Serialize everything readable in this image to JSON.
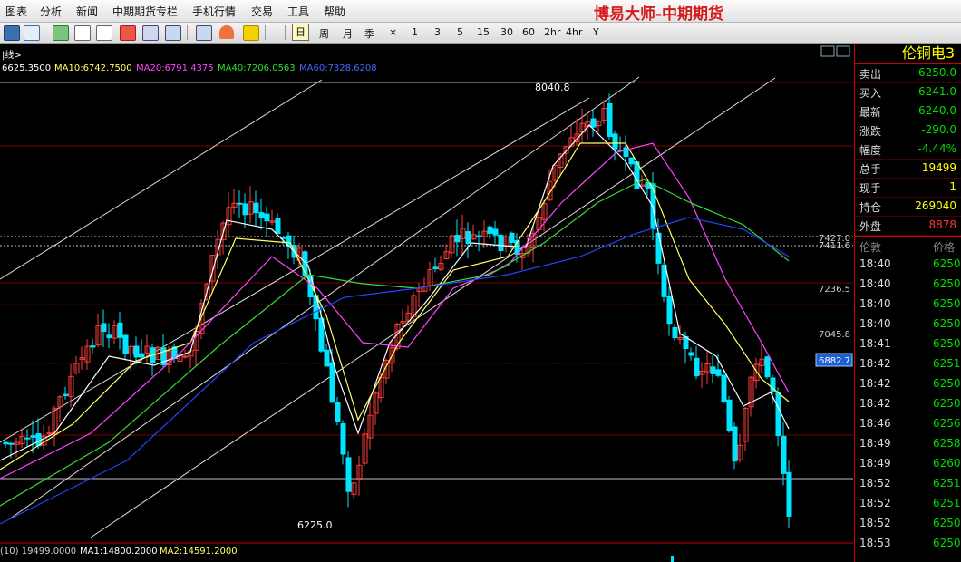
{
  "menu": {
    "items": [
      "图表",
      "分析",
      "新闻",
      "中期期货专栏",
      "手机行情",
      "交易",
      "工具",
      "帮助"
    ],
    "brand": "博易大师-中期期货"
  },
  "toolbar": {
    "periods": [
      "日",
      "周",
      "月",
      "季",
      "×",
      "1",
      "3",
      "5",
      "15",
      "30",
      "60",
      "2hr",
      "4hr",
      "Y"
    ],
    "active_period": "日"
  },
  "chart": {
    "indicator": {
      "prefix": "|线>",
      "close": "6625.3500",
      "ma10": "MA10:6742.7500",
      "ma20": "MA20:6791.4375",
      "ma40": "MA40:7206.0563",
      "ma60": "MA60:7328.6208"
    },
    "price_marks": {
      "high": "8040.8",
      "low": "6225.0",
      "r1": "7427.0",
      "r2": "7411.6",
      "r3": "7236.5",
      "r4": "7045.8",
      "cursor": "6882.7"
    },
    "volume_line": {
      "vol": "(10) 19499.0000",
      "ma1": "MA1:14800.2000",
      "ma2": "MA2:14591.2000"
    },
    "colors": {
      "up": "#ff3b3b",
      "down": "#00e5ff",
      "ma5": "#ffffff",
      "ma10": "#ffff66",
      "ma20": "#ff44ff",
      "ma40": "#33dd33",
      "ma60": "#2244ff"
    }
  },
  "quote": {
    "title": "伦铜电3",
    "rows": [
      {
        "label": "卖出",
        "value": "6250.0",
        "color": "#00dd00"
      },
      {
        "label": "买入",
        "value": "6241.0",
        "color": "#00dd00"
      },
      {
        "label": "最新",
        "value": "6240.0",
        "color": "#00dd00"
      },
      {
        "label": "涨跌",
        "value": "-290.0",
        "color": "#00dd00"
      },
      {
        "label": "幅度",
        "value": "-4.44%",
        "color": "#00dd00"
      },
      {
        "label": "总手",
        "value": "19499",
        "color": "#ffff00"
      },
      {
        "label": "现手",
        "value": "1",
        "color": "#ffff00"
      },
      {
        "label": "持仓",
        "value": "269040",
        "color": "#ffff00"
      },
      {
        "label": "外盘",
        "value": "8878",
        "color": "#ff3333"
      }
    ],
    "ticks_header": {
      "time": "伦敦",
      "price": "价格"
    },
    "ticks": [
      {
        "time": "18:40",
        "price": "6250"
      },
      {
        "time": "18:40",
        "price": "6250"
      },
      {
        "time": "18:40",
        "price": "6250"
      },
      {
        "time": "18:40",
        "price": "6250"
      },
      {
        "time": "18:41",
        "price": "6250"
      },
      {
        "time": "18:42",
        "price": "6251"
      },
      {
        "time": "18:42",
        "price": "6250"
      },
      {
        "time": "18:42",
        "price": "6250"
      },
      {
        "time": "18:46",
        "price": "6256"
      },
      {
        "time": "18:49",
        "price": "6258"
      },
      {
        "time": "18:49",
        "price": "6260"
      },
      {
        "time": "18:52",
        "price": "6251"
      },
      {
        "time": "18:52",
        "price": "6251"
      },
      {
        "time": "18:52",
        "price": "6250"
      },
      {
        "time": "18:53",
        "price": "6250"
      }
    ]
  }
}
